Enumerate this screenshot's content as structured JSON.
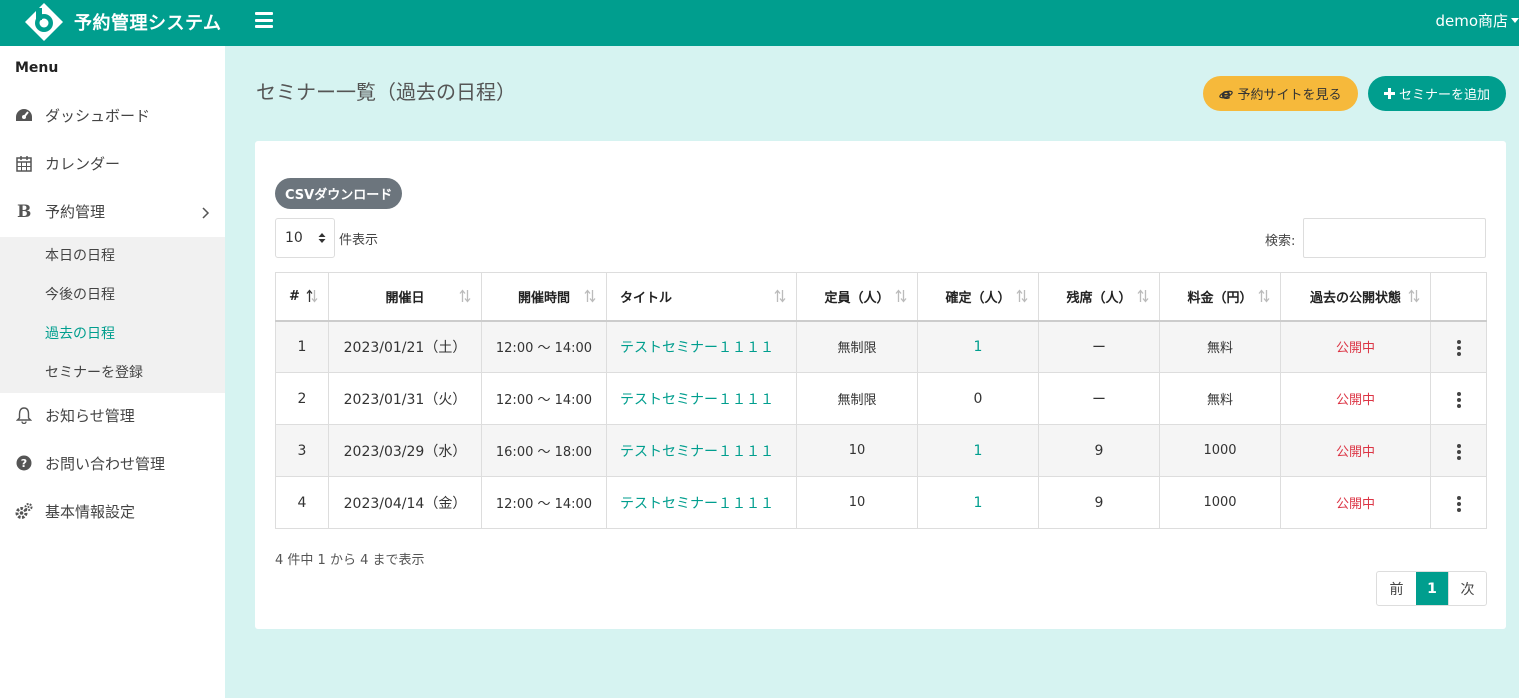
{
  "header": {
    "app_name": "予約管理システム",
    "user": "demo商店"
  },
  "sidebar": {
    "heading": "Menu",
    "items": [
      {
        "label": "ダッシュボード"
      },
      {
        "label": "カレンダー"
      },
      {
        "label": "予約管理"
      },
      {
        "label": "お知らせ管理"
      },
      {
        "label": "お問い合わせ管理"
      },
      {
        "label": "基本情報設定"
      }
    ],
    "submenu": [
      {
        "label": "本日の日程"
      },
      {
        "label": "今後の日程"
      },
      {
        "label": "過去の日程",
        "active": true
      },
      {
        "label": "セミナーを登録"
      }
    ]
  },
  "page": {
    "title": "セミナー一覧（過去の日程）",
    "site_button": "予約サイトを見る",
    "add_button": "セミナーを追加",
    "csv_button": "CSVダウンロード",
    "length_value": "10",
    "length_label": "件表示",
    "search_label": "検索:",
    "search_value": "",
    "info": "4 件中 1 から 4 まで表示",
    "pager": {
      "prev": "前",
      "current": "1",
      "next": "次"
    }
  },
  "table": {
    "headers": [
      "#",
      "開催日",
      "開催時間",
      "タイトル",
      "定員（人）",
      "確定（人）",
      "残席（人）",
      "料金（円）",
      "過去の公開状態"
    ],
    "rows": [
      [
        "1",
        "2023/01/21（土）",
        "12:00 〜 14:00",
        "テストセミナー１１１１",
        "無制限",
        "1",
        "ー",
        "無料",
        "公開中"
      ],
      [
        "2",
        "2023/01/31（火）",
        "12:00 〜 14:00",
        "テストセミナー１１１１",
        "無制限",
        "0",
        "ー",
        "無料",
        "公開中"
      ],
      [
        "3",
        "2023/03/29（水）",
        "16:00 〜 18:00",
        "テストセミナー１１１１",
        "10",
        "1",
        "9",
        "1000",
        "公開中"
      ],
      [
        "4",
        "2023/04/14（金）",
        "12:00 〜 14:00",
        "テストセミナー１１１１",
        "10",
        "1",
        "9",
        "1000",
        "公開中"
      ]
    ]
  },
  "colors": {
    "brand": "#009e8e",
    "background": "#d6f3f1",
    "accent_yellow": "#f6b93b",
    "status_red": "#dc3545"
  }
}
